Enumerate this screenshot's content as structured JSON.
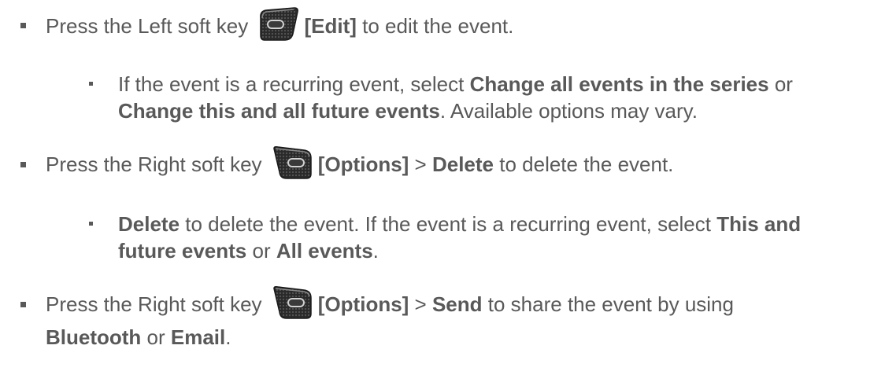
{
  "items": [
    {
      "level": 1,
      "parts": [
        {
          "t": "Press the Left soft key "
        },
        {
          "icon": "left-soft-key-icon"
        },
        {
          "b": "[Edit]"
        },
        {
          "t": " to edit the event."
        }
      ]
    },
    {
      "level": 2,
      "lines": [
        [
          {
            "t": "If the event is a recurring event, select "
          },
          {
            "b": "Change all events in the series"
          },
          {
            "t": " or"
          }
        ],
        [
          {
            "b": "Change this and all future events"
          },
          {
            "t": ". Available options may vary."
          }
        ]
      ]
    },
    {
      "level": 1,
      "parts": [
        {
          "t": "Press the Right soft key "
        },
        {
          "icon": "right-soft-key-icon"
        },
        {
          "b": "[Options]"
        },
        {
          "t": " > "
        },
        {
          "b": "Delete"
        },
        {
          "t": " to delete the event."
        }
      ]
    },
    {
      "level": 2,
      "lines": [
        [
          {
            "b": "Delete"
          },
          {
            "t": " to delete the event. If the event is a recurring event, select "
          },
          {
            "b": "This and"
          }
        ],
        [
          {
            "b": "future events"
          },
          {
            "t": " or "
          },
          {
            "b": "All events"
          },
          {
            "t": "."
          }
        ]
      ]
    },
    {
      "level": 1,
      "lines": [
        [
          {
            "t": "Press the Right soft key "
          },
          {
            "icon": "right-soft-key-icon"
          },
          {
            "b": "[Options]"
          },
          {
            "t": " > "
          },
          {
            "b": "Send"
          },
          {
            "t": " to share the event by using"
          }
        ],
        [
          {
            "b": "Bluetooth"
          },
          {
            "t": " or "
          },
          {
            "b": "Email"
          },
          {
            "t": "."
          }
        ]
      ]
    }
  ],
  "colors": {
    "text": "#595959",
    "key_body": "#2e2e2e",
    "key_edge": "#6a6a6a",
    "key_button": "#c8c8c8"
  }
}
